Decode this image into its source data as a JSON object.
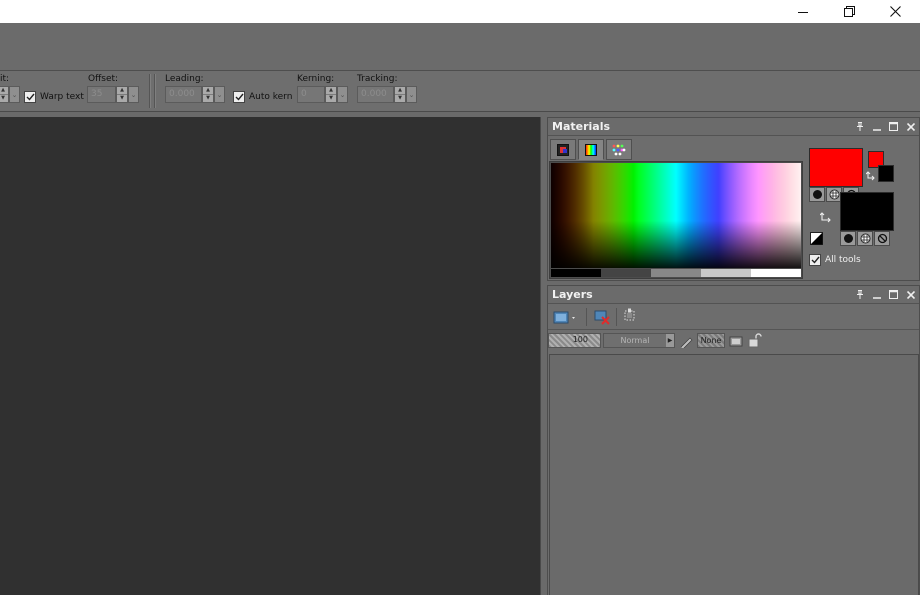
{
  "window": {
    "controls": [
      {
        "id": "minimize",
        "icon": "minimize-icon"
      },
      {
        "id": "restore",
        "icon": "restore-icon"
      },
      {
        "id": "close",
        "icon": "close-icon"
      }
    ]
  },
  "toolbar": {
    "unit_label_partial": "it:",
    "warp_text": {
      "label": "Warp text",
      "checked": true
    },
    "offset": {
      "label": "Offset:",
      "value": "35"
    },
    "leading": {
      "label": "Leading:",
      "value": "0.000"
    },
    "auto_kern": {
      "label": "Auto kern",
      "checked": true
    },
    "kerning": {
      "label": "Kerning:",
      "value": "0"
    },
    "tracking": {
      "label": "Tracking:",
      "value": "0.000"
    }
  },
  "materials": {
    "title": "Materials",
    "tabs": [
      {
        "id": "frame",
        "icon": "frame-palette-icon",
        "active": false
      },
      {
        "id": "rainbow",
        "icon": "rainbow-palette-icon",
        "active": true
      },
      {
        "id": "swatches",
        "icon": "swatches-palette-icon",
        "active": false
      }
    ],
    "foreground_color": "#ff0000",
    "background_color": "#000000",
    "all_tools": {
      "label": "All tools",
      "checked": true
    }
  },
  "layers": {
    "title": "Layers",
    "opacity": "100",
    "blend_mode": "Normal",
    "mask": "None"
  }
}
